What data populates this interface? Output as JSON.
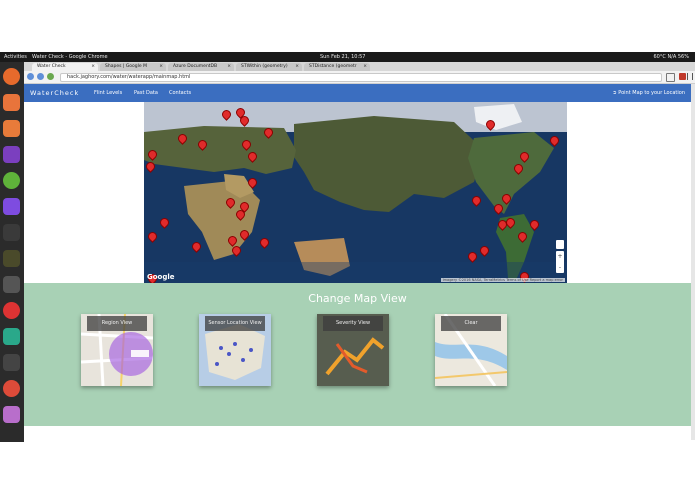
{
  "os_topbar": {
    "activities": "Activities",
    "app": "Water Check - Google Chrome",
    "clock": "Sun Feb 21, 10:57",
    "status": "60°C  N/A  56%"
  },
  "tabs": [
    {
      "label": "Water Check"
    },
    {
      "label": "Shapes | Google M"
    },
    {
      "label": "Azure DocumentDB"
    },
    {
      "label": "STWithin (geometry)"
    },
    {
      "label": "STDistance (geometr"
    }
  ],
  "address": {
    "url": "hack.jaghory.com/water/waterapp/mainmap.html"
  },
  "app": {
    "brand": "WaterCheck",
    "nav": [
      "Flint Levels",
      "Past Data",
      "Contacts"
    ],
    "point_map": "Point Map to your Location"
  },
  "map": {
    "logo": "Google",
    "attribution": "Imagery ©2016 NASA, TerraMetrics   Terms of Use   Report a map error",
    "zoom_in": "+",
    "zoom_out": "-"
  },
  "views": {
    "title": "Change Map View",
    "cards": [
      {
        "label": "Region View"
      },
      {
        "label": "Sensor Location View"
      },
      {
        "label": "Severity View"
      },
      {
        "label": "Clear"
      }
    ]
  },
  "colors": {
    "nav_bar": "#3b6ec0",
    "view_section": "#a8d1b5",
    "pin": "#e02b2b"
  }
}
